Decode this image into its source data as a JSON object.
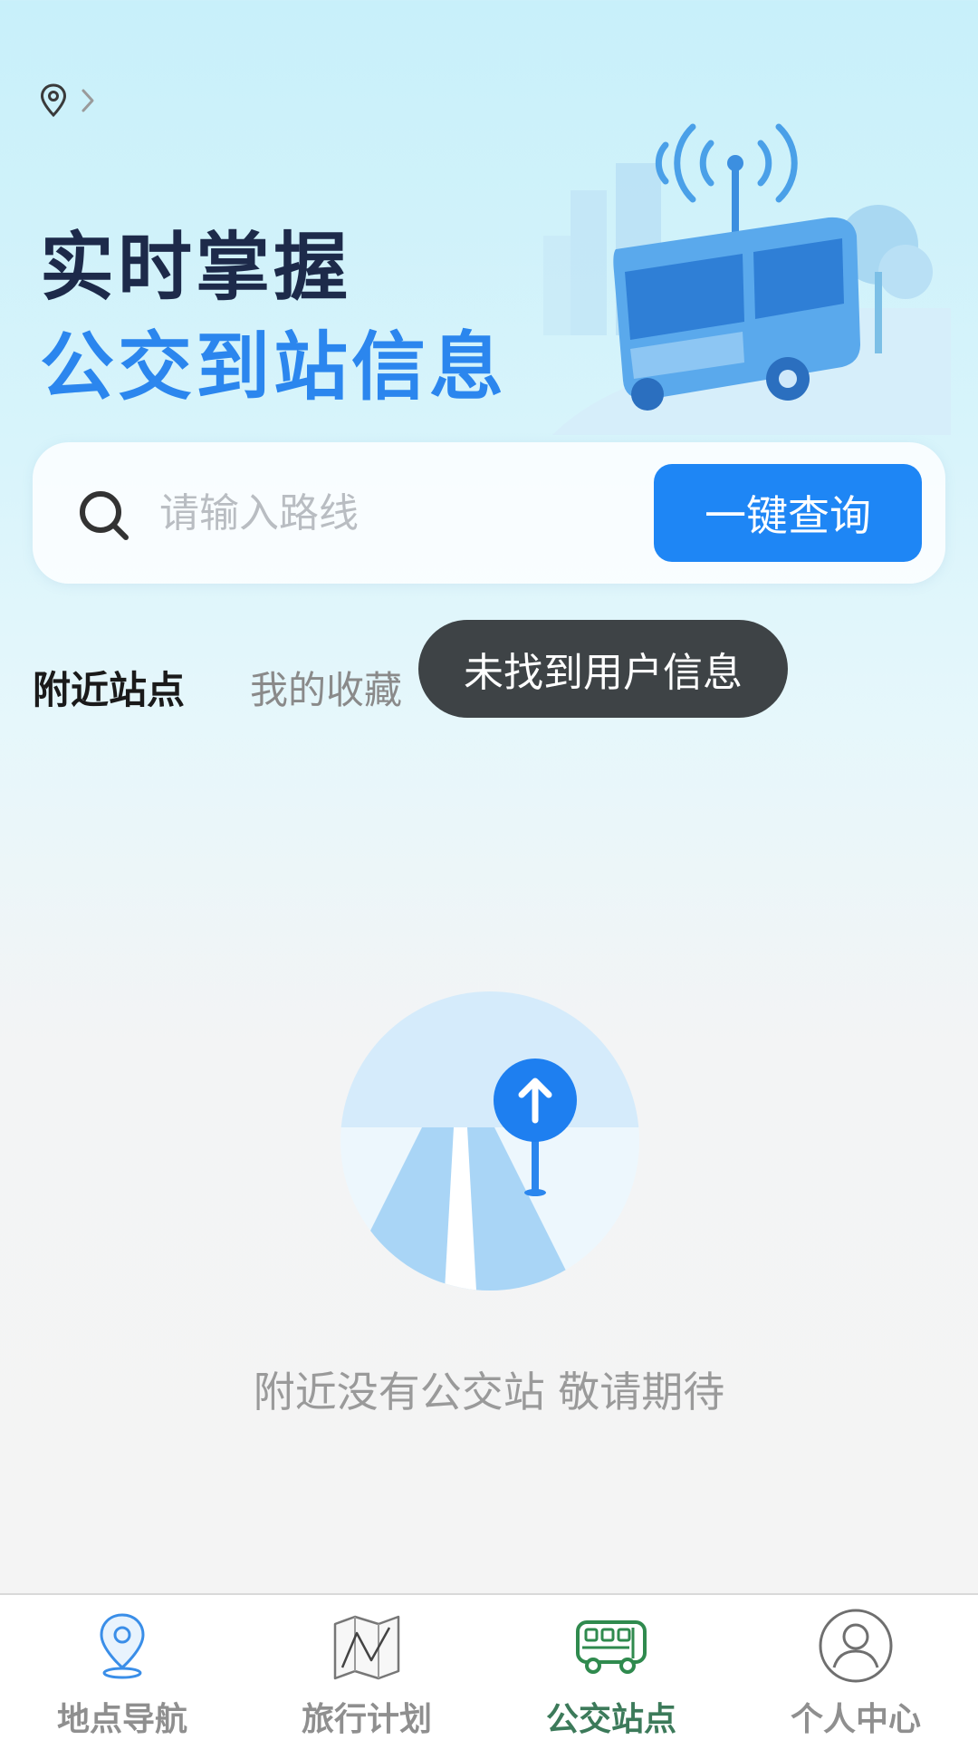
{
  "header": {
    "location_icon": "location-pin-icon",
    "chevron_icon": "chevron-right-icon"
  },
  "hero": {
    "line1": "实时掌握",
    "line2": "公交到站信息",
    "illustration": "bus-signal-illustration"
  },
  "search": {
    "placeholder": "请输入路线",
    "value": "",
    "button_label": "一键查询"
  },
  "tabs": [
    {
      "label": "附近站点",
      "active": true
    },
    {
      "label": "我的收藏",
      "active": false
    }
  ],
  "toast": {
    "text": "未找到用户信息"
  },
  "empty_state": {
    "text": "附近没有公交站 敬请期待",
    "illustration": "road-signpost-illustration"
  },
  "bottom_nav": {
    "items": [
      {
        "label": "地点导航",
        "icon": "location-pin-icon",
        "active": false
      },
      {
        "label": "旅行计划",
        "icon": "folded-map-icon",
        "active": false
      },
      {
        "label": "公交站点",
        "icon": "bus-icon",
        "active": true
      },
      {
        "label": "个人中心",
        "icon": "user-icon",
        "active": false
      }
    ]
  },
  "colors": {
    "accent": "#1e86f5",
    "hero_dark": "#1d2a4a",
    "hero_blue": "#2b86ee",
    "nav_active": "#3c7a5a",
    "toast_bg": "#3e4346"
  }
}
